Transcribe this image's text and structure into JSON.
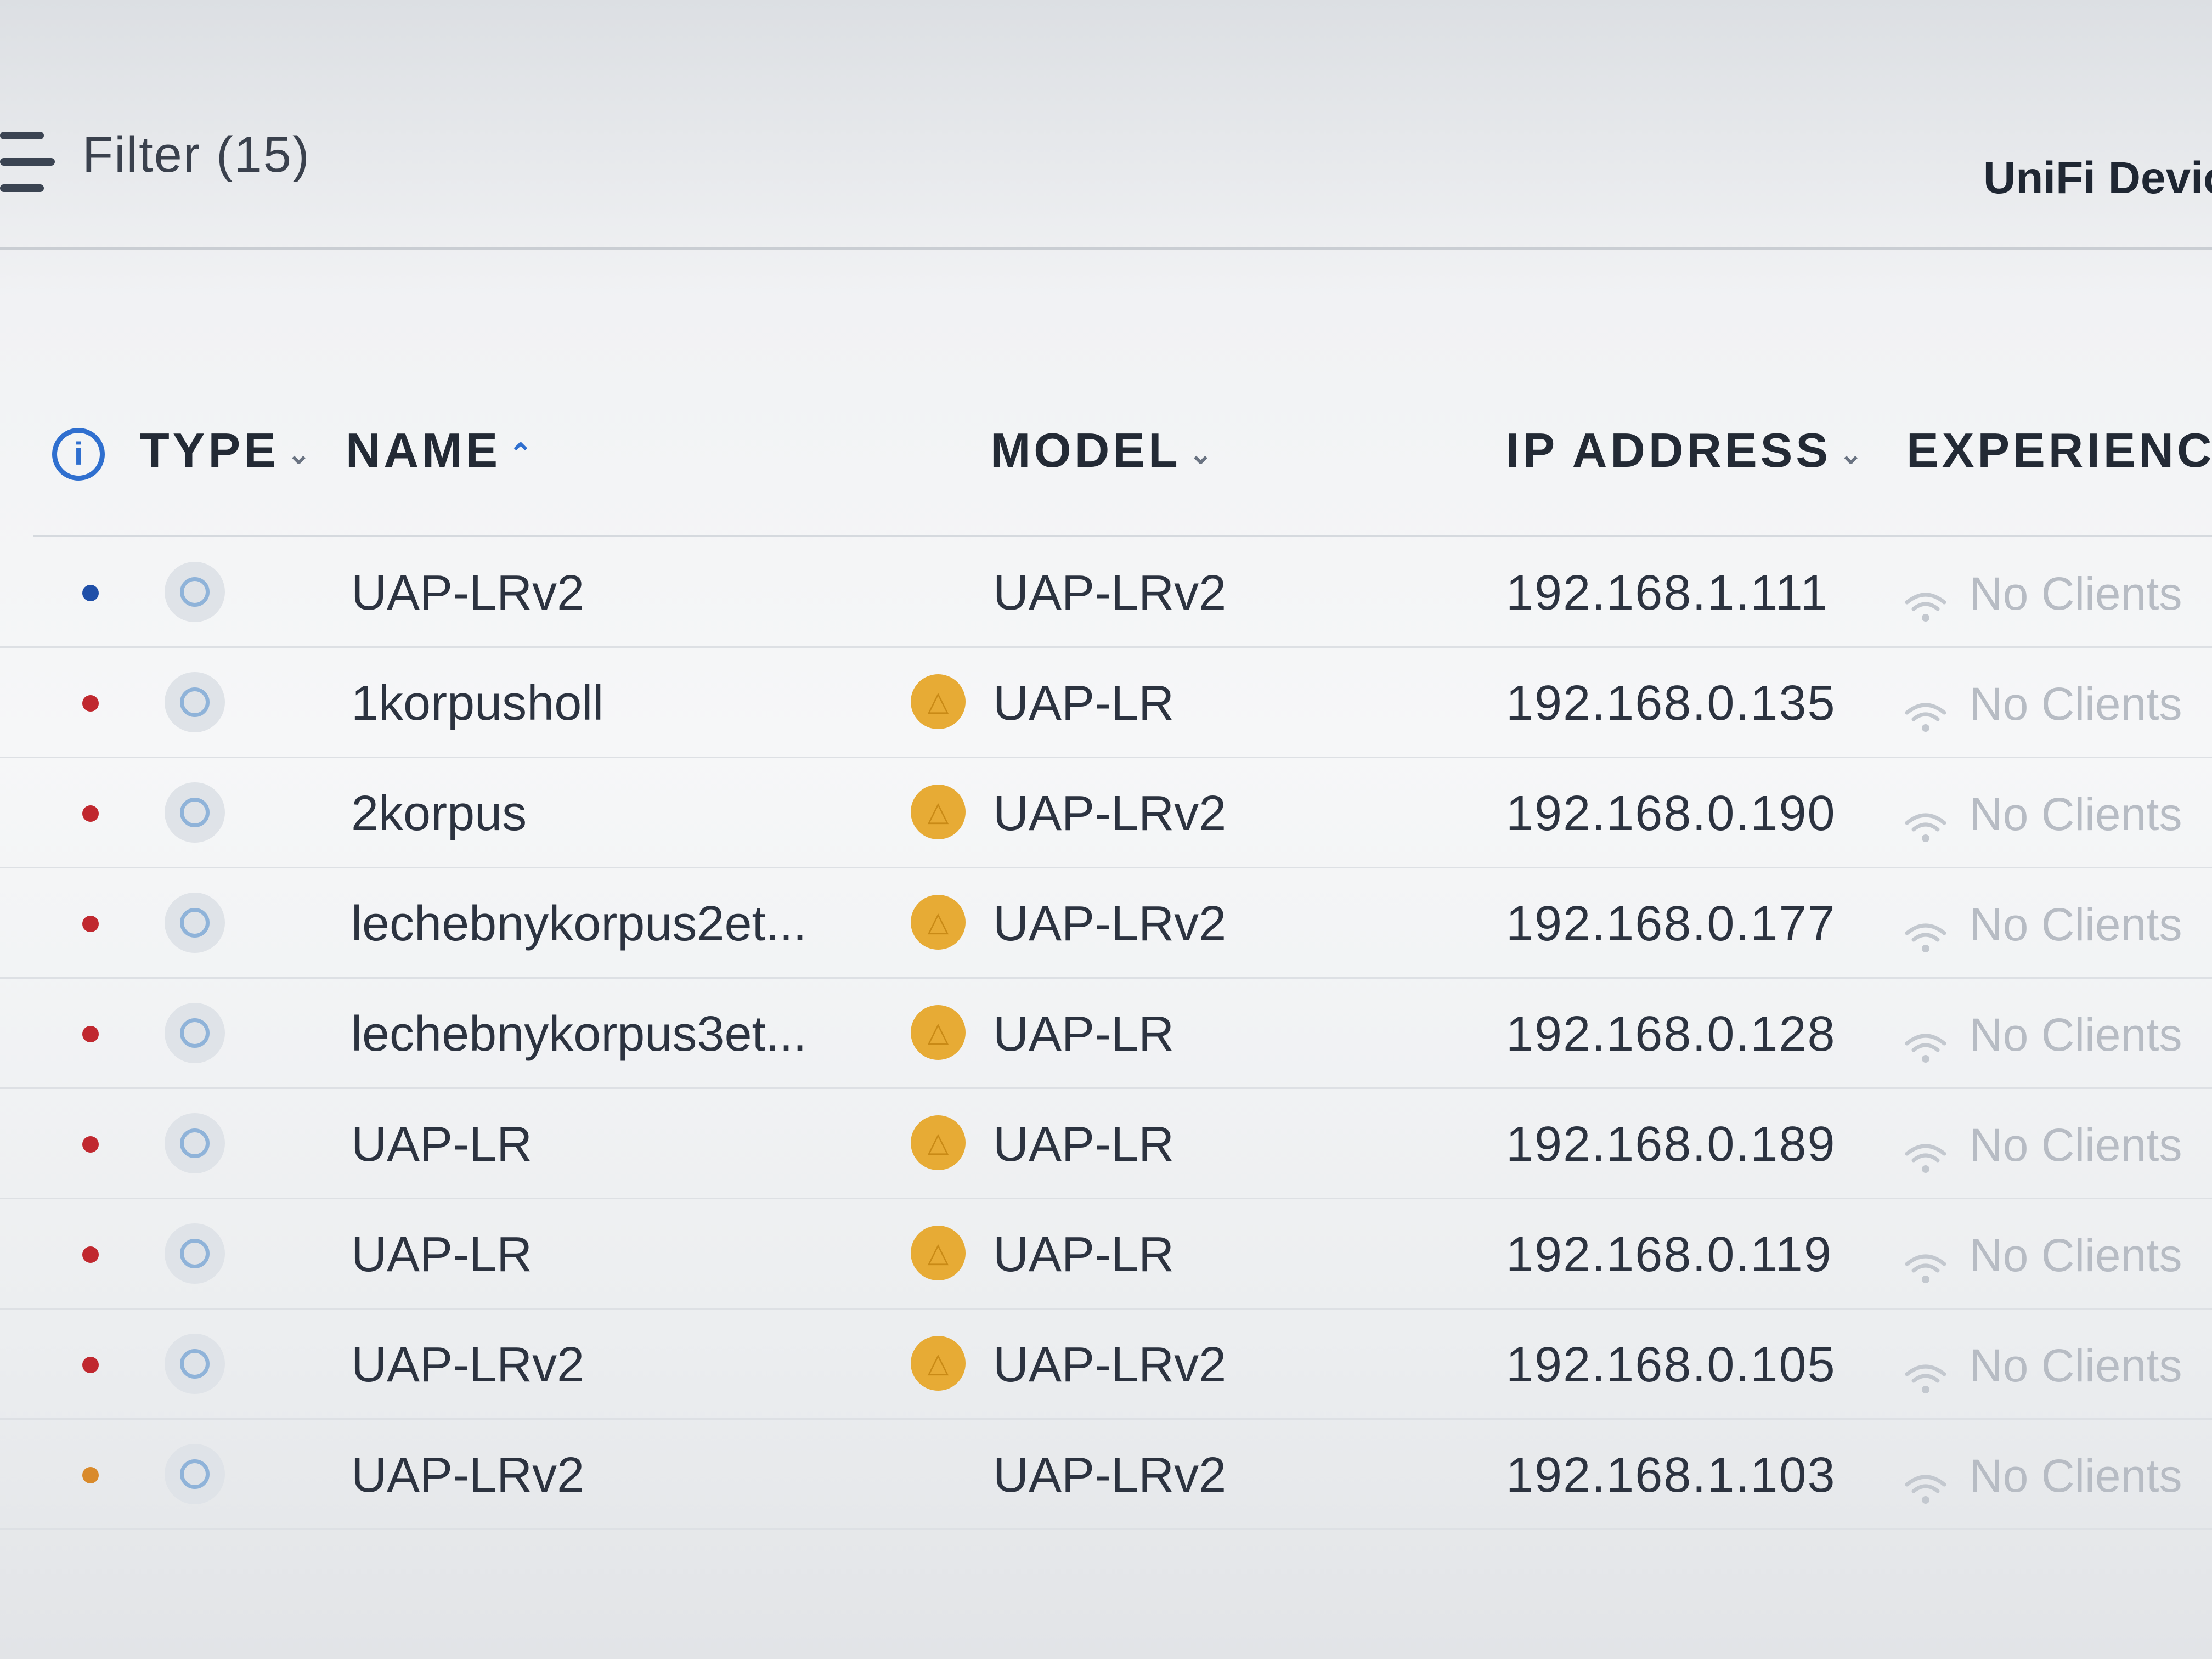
{
  "toolbar": {
    "filter_label": "Filter (15)",
    "device_tab": "UniFi Devic"
  },
  "table": {
    "headers": {
      "type": "TYPE",
      "name": "NAME",
      "model": "MODEL",
      "ip": "IP ADDRESS",
      "experience": "EXPERIENCE"
    },
    "rows": [
      {
        "status_color": "#1f4fa8",
        "name": "UAP-LRv2",
        "model": "UAP-LRv2",
        "warning": false,
        "ip": "192.168.1.111",
        "experience": "No Clients"
      },
      {
        "status_color": "#c0282f",
        "name": "1korpusholl",
        "model": "UAP-LR",
        "warning": true,
        "ip": "192.168.0.135",
        "experience": "No Clients"
      },
      {
        "status_color": "#c0282f",
        "name": "2korpus",
        "model": "UAP-LRv2",
        "warning": true,
        "ip": "192.168.0.190",
        "experience": "No Clients"
      },
      {
        "status_color": "#c0282f",
        "name": "lechebnykorpus2et...",
        "model": "UAP-LRv2",
        "warning": true,
        "ip": "192.168.0.177",
        "experience": "No Clients"
      },
      {
        "status_color": "#c0282f",
        "name": "lechebnykorpus3et...",
        "model": "UAP-LR",
        "warning": true,
        "ip": "192.168.0.128",
        "experience": "No Clients"
      },
      {
        "status_color": "#c0282f",
        "name": "UAP-LR",
        "model": "UAP-LR",
        "warning": true,
        "ip": "192.168.0.189",
        "experience": "No Clients"
      },
      {
        "status_color": "#c0282f",
        "name": "UAP-LR",
        "model": "UAP-LR",
        "warning": true,
        "ip": "192.168.0.119",
        "experience": "No Clients"
      },
      {
        "status_color": "#c0282f",
        "name": "UAP-LRv2",
        "model": "UAP-LRv2",
        "warning": true,
        "ip": "192.168.0.105",
        "experience": "No Clients"
      },
      {
        "status_color": "#d98a2b",
        "name": "UAP-LRv2",
        "model": "UAP-LRv2",
        "warning": false,
        "ip": "192.168.1.103",
        "experience": "No Clients"
      }
    ]
  },
  "icons": {
    "filter": "filter-lines-icon",
    "info": "info-circle-icon",
    "type": "access-point-icon",
    "warning": "warning-triangle-icon",
    "wifi": "wifi-icon"
  },
  "colors": {
    "accent": "#2f6fcf",
    "warning": "#e7ab35",
    "offline": "#c0282f",
    "online": "#1f4fa8"
  }
}
